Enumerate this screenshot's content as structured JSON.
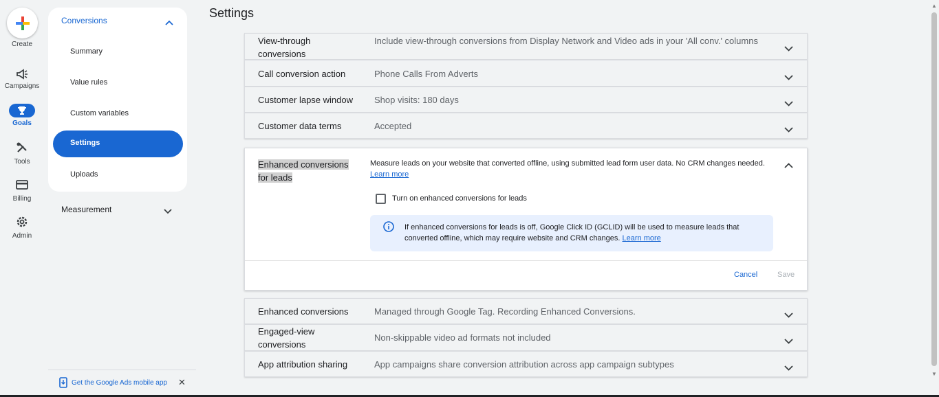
{
  "rail": {
    "create_label": "Create",
    "items": [
      {
        "label": "Campaigns",
        "icon": "megaphone-icon"
      },
      {
        "label": "Goals",
        "icon": "trophy-icon"
      },
      {
        "label": "Tools",
        "icon": "tools-icon"
      },
      {
        "label": "Billing",
        "icon": "credit-card-icon"
      },
      {
        "label": "Admin",
        "icon": "gear-icon"
      }
    ]
  },
  "subnav": {
    "header": "Conversions",
    "items": [
      "Summary",
      "Value rules",
      "Custom variables",
      "Settings",
      "Uploads"
    ],
    "measurement": "Measurement",
    "promo": "Get the Google Ads mobile app",
    "promo_close": "✕"
  },
  "page": {
    "title": "Settings"
  },
  "rows_top": [
    {
      "label": "View-through conversions",
      "value": "Include view-through conversions from Display Network and Video ads in your 'All conv.' columns"
    },
    {
      "label": "Call conversion action",
      "value": "Phone Calls From Adverts"
    },
    {
      "label": "Customer lapse window",
      "value": "Shop visits: 180 days"
    },
    {
      "label": "Customer data terms",
      "value": "Accepted"
    }
  ],
  "expanded": {
    "label": "Enhanced conversions for leads",
    "description": "Measure leads on your website that converted offline, using submitted lead form user data. No CRM changes needed.",
    "learn_more": "Learn more",
    "checkbox_label": "Turn on enhanced conversions for leads",
    "checkbox_checked": false,
    "info_text": "If enhanced conversions for leads is off, Google Click ID (GCLID) will be used to measure leads that converted offline, which may require website and CRM changes.",
    "info_learn_more": "Learn more",
    "cancel": "Cancel",
    "save": "Save"
  },
  "rows_bottom": [
    {
      "label": "Enhanced conversions",
      "value": "Managed through Google Tag. Recording Enhanced Conversions."
    },
    {
      "label": "Engaged-view conversions",
      "value": "Non-skippable video ad formats not included"
    },
    {
      "label": "App attribution sharing",
      "value": "App campaigns share conversion attribution across app campaign subtypes"
    }
  ],
  "colors": {
    "accent": "#1967d2",
    "background": "#f1f3f4",
    "info_bg": "#e8f0fe"
  }
}
